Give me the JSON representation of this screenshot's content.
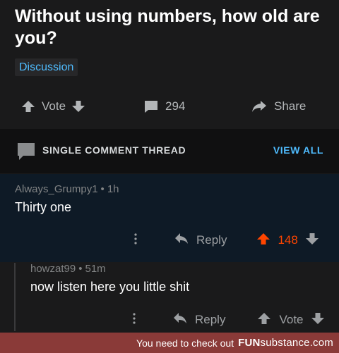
{
  "post": {
    "title": "Without using numbers, how old are you?",
    "flair": "Discussion"
  },
  "actions": {
    "vote_label": "Vote",
    "comment_count": "294",
    "share_label": "Share"
  },
  "thread": {
    "label": "SINGLE COMMENT THREAD",
    "view_all": "VIEW ALL"
  },
  "comments": [
    {
      "author": "Always_Grumpy1",
      "age": "1h",
      "body": "Thirty one",
      "reply_label": "Reply",
      "score": "148",
      "upvoted": true
    },
    {
      "author": "howzat99",
      "age": "51m",
      "body": "now listen here you little shit",
      "reply_label": "Reply",
      "vote_label": "Vote"
    }
  ],
  "footer": {
    "message": "You need to check out",
    "logo_bold": "FUN",
    "logo_rest": "substance.com"
  },
  "colors": {
    "accent_blue": "#4fbcff",
    "upvote_orange": "#ff4500",
    "background": "#1a1a1b",
    "highlight": "#0e1a26",
    "footer": "#8a3a38"
  }
}
